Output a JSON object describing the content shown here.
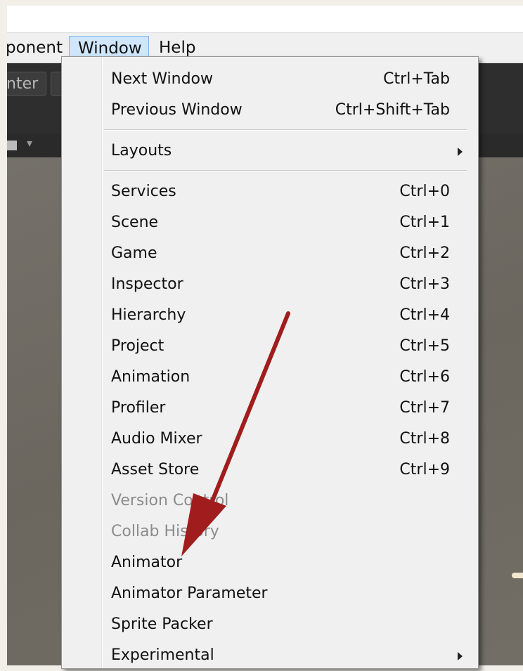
{
  "menubar": {
    "component_label": "ponent",
    "window_label": "Window",
    "help_label": "Help"
  },
  "toolbar": {
    "center_label": "nter"
  },
  "window_menu": {
    "groups": [
      [
        {
          "label": "Next Window",
          "shortcut": "Ctrl+Tab"
        },
        {
          "label": "Previous Window",
          "shortcut": "Ctrl+Shift+Tab"
        }
      ],
      [
        {
          "label": "Layouts",
          "shortcut": "",
          "submenu": true
        }
      ],
      [
        {
          "label": "Services",
          "shortcut": "Ctrl+0"
        },
        {
          "label": "Scene",
          "shortcut": "Ctrl+1"
        },
        {
          "label": "Game",
          "shortcut": "Ctrl+2"
        },
        {
          "label": "Inspector",
          "shortcut": "Ctrl+3"
        },
        {
          "label": "Hierarchy",
          "shortcut": "Ctrl+4"
        },
        {
          "label": "Project",
          "shortcut": "Ctrl+5"
        },
        {
          "label": "Animation",
          "shortcut": "Ctrl+6"
        },
        {
          "label": "Profiler",
          "shortcut": "Ctrl+7"
        },
        {
          "label": "Audio Mixer",
          "shortcut": "Ctrl+8"
        },
        {
          "label": "Asset Store",
          "shortcut": "Ctrl+9"
        },
        {
          "label": "Version Control",
          "shortcut": "",
          "disabled": true
        },
        {
          "label": "Collab History",
          "shortcut": "",
          "disabled": true
        },
        {
          "label": "Animator",
          "shortcut": ""
        },
        {
          "label": "Animator Parameter",
          "shortcut": ""
        },
        {
          "label": "Sprite Packer",
          "shortcut": ""
        },
        {
          "label": "Experimental",
          "shortcut": "",
          "submenu": true
        }
      ]
    ]
  },
  "colors": {
    "annotation_arrow": "#a11d1d",
    "menu_highlight": "#cfe6fb",
    "disabled_text": "#8c8c8c"
  }
}
